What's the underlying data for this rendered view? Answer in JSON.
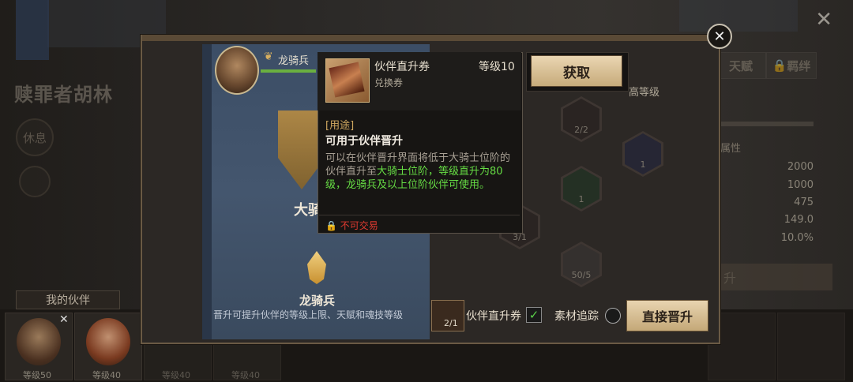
{
  "background": {
    "hero_name": "赎罪者胡林",
    "rest_button": "休息",
    "outer_close": "✕",
    "right_tabs": [
      "天赋",
      "羁绊"
    ],
    "attr_label": "属性",
    "stats": [
      "2000",
      "1000",
      "475",
      "149.0",
      "10.0%"
    ],
    "right_hint": "高等级",
    "right_button": "升"
  },
  "partners": {
    "tab_label": "我的伙伴",
    "slots": [
      {
        "level": "等级50"
      },
      {
        "level": "等级40"
      },
      {
        "level": "等级40"
      },
      {
        "level": "等级40"
      }
    ]
  },
  "modal": {
    "close": "✕",
    "current_rank": "龙骑兵",
    "next_rank_title": "大骑士",
    "bottom_rank": "龙骑兵",
    "bottom_desc": "晋升可提升伙伴的等级上限、天赋和魂技等级",
    "hex_counts": [
      "2/2",
      "1",
      "1",
      "3/1",
      "50/5"
    ],
    "material_count": "2/1",
    "material_label": "伙伴直升券",
    "check_mark": "✓",
    "track_label": "素材追踪",
    "promote_button": "直接晋升"
  },
  "tooltip": {
    "item_name": "伙伴直升券",
    "level": "等级10",
    "type": "兑换券",
    "use_heading": "[用途]",
    "use_title": "可用于伙伴晋升",
    "desc_part1": "可以在伙伴晋升界面将低于大骑士位阶的伙伴直升至",
    "desc_green": "大骑士位阶，等级直升为80级，龙骑兵及以上位阶伙伴可使用。",
    "lock_text": "不可交易",
    "get_button": "获取"
  },
  "colors": {
    "accent_gold": "#c6aa7a",
    "green_text": "#66dd44",
    "lock_red": "#e03a30"
  }
}
